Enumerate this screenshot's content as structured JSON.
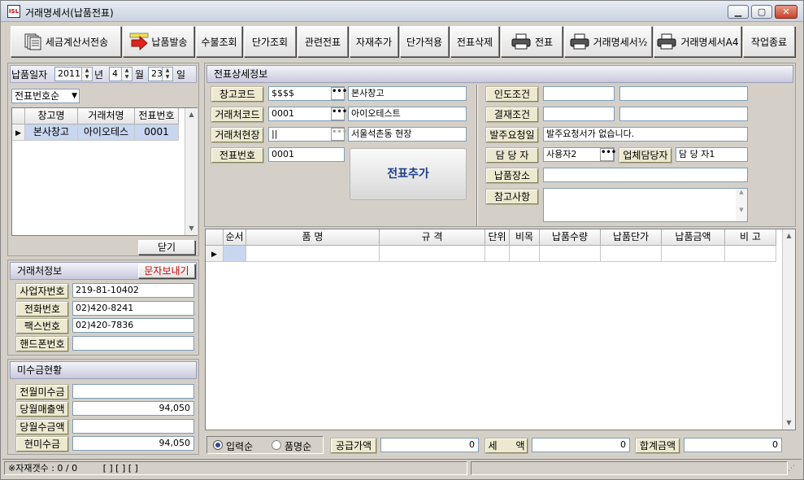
{
  "window": {
    "title": "거래명세서(납품전표)",
    "app_badge": "ISL"
  },
  "toolbar": [
    {
      "label": "세금계산서전송",
      "icon": "document-stack-icon"
    },
    {
      "label": "납품발송",
      "icon": "send-arrow-icon"
    },
    {
      "label": "수불조회"
    },
    {
      "label": "단가조회"
    },
    {
      "label": "관련전표"
    },
    {
      "label": "자재추가"
    },
    {
      "label": "단가적용"
    },
    {
      "label": "전표삭제"
    },
    {
      "label": "전표",
      "icon": "printer-icon"
    },
    {
      "label": "거래명세서½",
      "icon": "printer-icon"
    },
    {
      "label": "거래명세서A4",
      "icon": "printer-icon"
    },
    {
      "label": "작업종료"
    }
  ],
  "delivery_date": {
    "label": "납품일자",
    "year": "2011",
    "year_unit": "년",
    "month": "4",
    "month_unit": "월",
    "day": "23",
    "day_unit": "일"
  },
  "sort_select": {
    "value": "전표번호순"
  },
  "list_grid": {
    "columns": [
      "창고명",
      "거래처명",
      "전표번호"
    ],
    "rows": [
      [
        "본사창고",
        "아이오테스",
        "0001"
      ]
    ]
  },
  "close_button": "닫기",
  "client_info": {
    "title": "거래처정보",
    "sms_button": "문자보내기",
    "fields": [
      {
        "label": "사업자번호",
        "value": "219-81-10402"
      },
      {
        "label": "전화번호",
        "value": "02)420-8241"
      },
      {
        "label": "팩스번호",
        "value": "02)420-7836"
      },
      {
        "label": "핸드폰번호",
        "value": ""
      }
    ]
  },
  "receivables": {
    "title": "미수금현황",
    "fields": [
      {
        "label": "전월미수금",
        "value": ""
      },
      {
        "label": "당월매출액",
        "value": "94,050"
      },
      {
        "label": "당월수금액",
        "value": ""
      },
      {
        "label": "현미수금",
        "value": "94,050"
      }
    ]
  },
  "detail": {
    "title": "전표상세정보",
    "warehouse_code": {
      "label": "창고코드",
      "code": "$$$$",
      "name": "본사창고"
    },
    "client_code": {
      "label": "거래처코드",
      "code": "0001",
      "name": "아이오테스트"
    },
    "client_site": {
      "label": "거래처현장",
      "code": "||",
      "name": "서울석촌동 현장"
    },
    "slip_no": {
      "label": "전표번호",
      "value": "0001"
    },
    "add_slip_button": "전표추가",
    "delivery_terms": {
      "label": "인도조건",
      "value1": "",
      "value2": ""
    },
    "payment_terms": {
      "label": "결재조건",
      "value1": "",
      "value2": ""
    },
    "order_date": {
      "label": "발주요청일",
      "value": "발주요청서가 없습니다."
    },
    "manager": {
      "label": "담 당 자",
      "value": "사용자2"
    },
    "vendor_manager": {
      "label": "업체담당자",
      "value": "담 당 자1"
    },
    "delivery_place": {
      "label": "납품장소",
      "value": ""
    },
    "remarks": {
      "label": "참고사항",
      "value": ""
    }
  },
  "items_grid": {
    "columns": [
      "순서",
      "품 명",
      "규 격",
      "단위",
      "비목",
      "납품수량",
      "납품단가",
      "납품금액",
      "비 고"
    ]
  },
  "footer": {
    "radio_input_order": "입력순",
    "radio_item_order": "품명순",
    "supply_label": "공급가액",
    "supply_value": "0",
    "tax_label": "세      액",
    "tax_value": "0",
    "total_label": "합계금액",
    "total_value": "0"
  },
  "status": {
    "item_count": "※자재갯수 : 0 / 0",
    "brackets": "[ ] [ ] [ ]"
  }
}
